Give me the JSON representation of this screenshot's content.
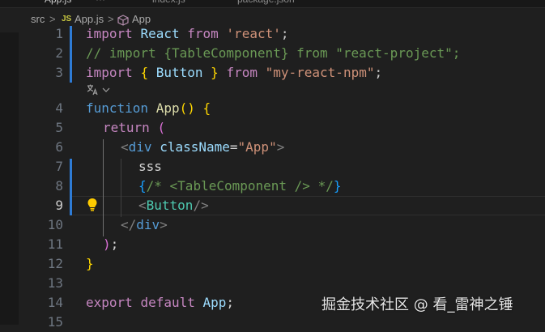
{
  "tabs": [
    {
      "label": "App.js"
    },
    {
      "label": "index.js"
    },
    {
      "label": "package.json"
    }
  ],
  "breadcrumbs": {
    "folder": "src",
    "file_badge": "JS",
    "file": "App.js",
    "symbol": "App",
    "separator": ">"
  },
  "codelens_icon": "translate-icon",
  "line_numbers": [
    "1",
    "2",
    "3",
    "4",
    "5",
    "6",
    "7",
    "8",
    "9",
    "10",
    "11",
    "12",
    "13",
    "14",
    "15"
  ],
  "current_line": "9",
  "code": {
    "l1": {
      "kw": "import",
      "id": "React",
      "from": "from",
      "str": "'react'",
      "semi": ";"
    },
    "l2": {
      "comment": "// import {TableComponent} from \"react-project\";"
    },
    "l3": {
      "kw": "import",
      "brace_open": "{",
      "id": "Button",
      "brace_close": "}",
      "from": "from",
      "str": "\"my-react-npm\"",
      "semi": ";"
    },
    "l4": {
      "kw": "function",
      "fn": "App",
      "parens": "()",
      "brace": "{"
    },
    "l5": {
      "kw": "return",
      "paren": "("
    },
    "l6": {
      "open": "<",
      "tag": "div",
      "attr": "className",
      "eq": "=",
      "str": "\"App\"",
      "close": ">"
    },
    "l7": {
      "text": "sss"
    },
    "l8": {
      "brace_open": "{",
      "comment": "/* <TableComponent /> */",
      "brace_close": "}"
    },
    "l9": {
      "open": "<",
      "tag": "Button",
      "close": "/>"
    },
    "l10": {
      "open": "</",
      "tag": "div",
      "close": ">"
    },
    "l11": {
      "paren": ")",
      "semi": ";"
    },
    "l12": {
      "brace": "}"
    },
    "l14": {
      "kw1": "export",
      "kw2": "default",
      "id": "App",
      "semi": ";"
    }
  },
  "watermark": "掘金技术社区 @ 看_雷神之锤",
  "colors": {
    "editor_bg": "#1f1f1f",
    "keyword": "#569cd6",
    "control": "#c586c0",
    "string": "#ce9178",
    "comment": "#6a9955",
    "function": "#dcdcaa",
    "variable": "#9cdcfe",
    "component": "#4ec9b0",
    "git_modified": "#2e7bd5"
  }
}
